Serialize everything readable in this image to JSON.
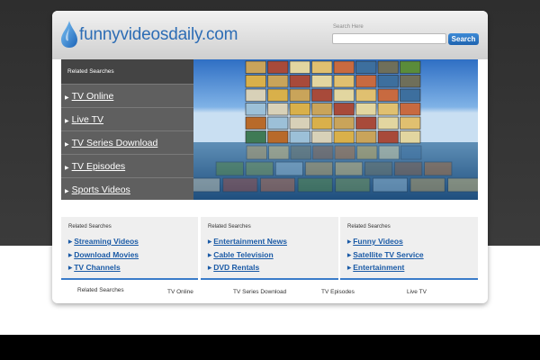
{
  "site": {
    "logo_text": "funnyvideosdaily.com",
    "brand_color": "#2d6db5"
  },
  "search": {
    "label": "Search Here",
    "value": "",
    "button_label": "Search"
  },
  "hero": {
    "title": "Related Searches",
    "links": [
      "TV Online",
      "Live TV",
      "TV Series Download",
      "TV Episodes",
      "Sports Videos"
    ]
  },
  "columns": [
    {
      "title": "Related Searches",
      "links": [
        "Streaming Videos",
        "Download Movies",
        "TV Channels"
      ]
    },
    {
      "title": "Related Searches",
      "links": [
        "Entertainment News",
        "Cable Television",
        "DVD Rentals"
      ]
    },
    {
      "title": "Related Searches",
      "links": [
        "Funny Videos",
        "Satellite TV Service",
        "Entertainment"
      ]
    }
  ],
  "footer": {
    "title": "Related Searches",
    "links": [
      "TV Online",
      "TV Series Download",
      "TV Episodes",
      "Live TV"
    ]
  },
  "colors": {
    "link_blue": "#1a5aa6",
    "accent_line": "#3a7cc9",
    "dark_bg": "#333333"
  },
  "icons": [
    "water-drop-icon",
    "arrow-bullet-icon"
  ]
}
